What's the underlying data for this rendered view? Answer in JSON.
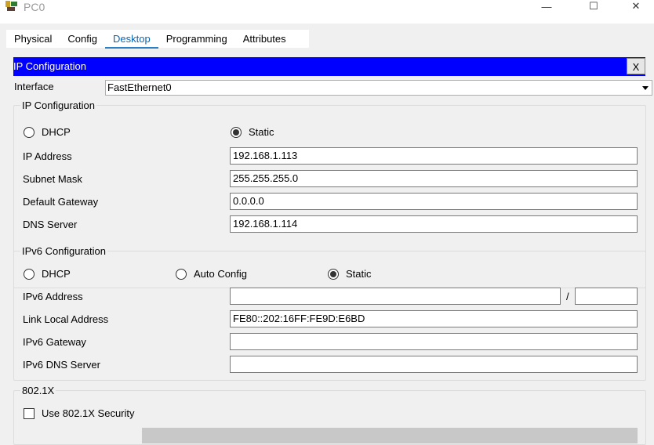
{
  "window": {
    "title": "PC0",
    "minimize": "—",
    "maximize": "☐",
    "close": "✕"
  },
  "tabs": [
    {
      "label": "Physical"
    },
    {
      "label": "Config"
    },
    {
      "label": "Desktop",
      "active": true
    },
    {
      "label": "Programming"
    },
    {
      "label": "Attributes"
    }
  ],
  "dialog": {
    "title": "IP Configuration",
    "close": "X"
  },
  "interface": {
    "label": "Interface",
    "value": "FastEthernet0"
  },
  "ipv4": {
    "legend": "IP Configuration",
    "dhcp": "DHCP",
    "static": "Static",
    "mode": "Static",
    "ip_label": "IP Address",
    "ip": "192.168.1.113",
    "mask_label": "Subnet Mask",
    "mask": "255.255.255.0",
    "gw_label": "Default Gateway",
    "gw": "0.0.0.0",
    "dns_label": "DNS Server",
    "dns": "192.168.1.114"
  },
  "ipv6": {
    "legend": "IPv6 Configuration",
    "dhcp": "DHCP",
    "auto": "Auto Config",
    "static": "Static",
    "mode": "Static",
    "addr_label": "IPv6 Address",
    "addr": "",
    "slash": "/",
    "prefix": "",
    "ll_label": "Link Local Address",
    "ll": "FE80::202:16FF:FE9D:E6BD",
    "gw_label": "IPv6 Gateway",
    "gw": "",
    "dns_label": "IPv6 DNS Server",
    "dns": ""
  },
  "dot1x": {
    "legend": "802.1X",
    "use_label": "Use 802.1X Security",
    "enabled": false
  }
}
